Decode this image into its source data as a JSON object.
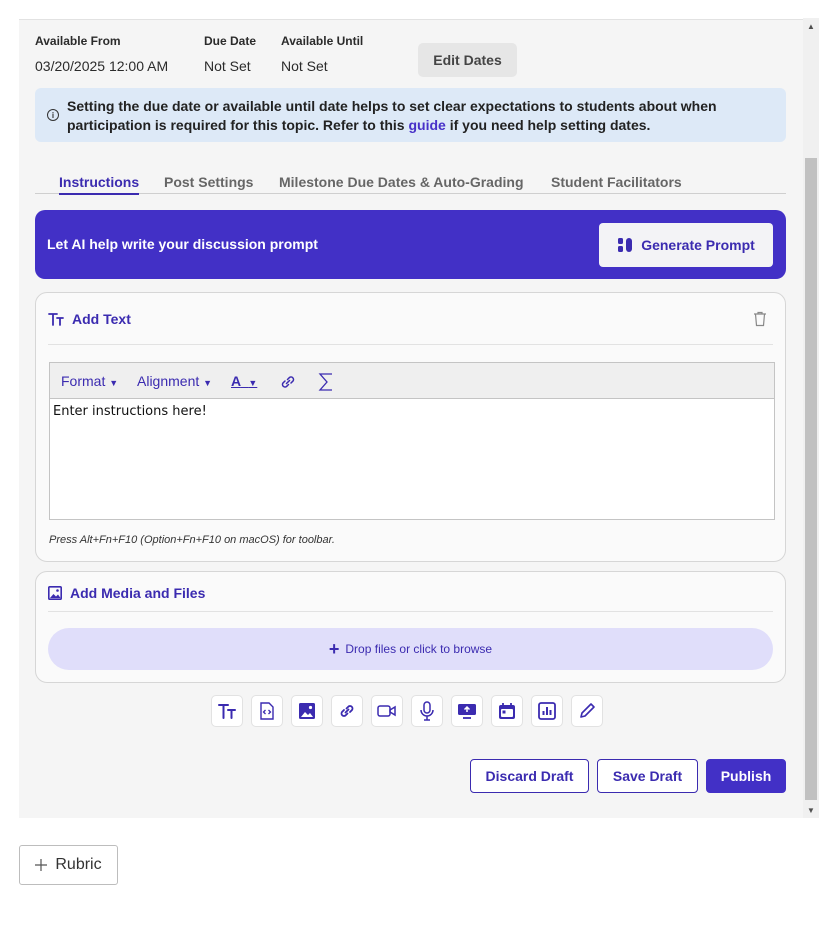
{
  "dates": {
    "available_from_label": "Available From",
    "available_from_value": "03/20/2025 12:00 AM",
    "due_date_label": "Due Date",
    "due_date_value": "Not Set",
    "available_until_label": "Available Until",
    "available_until_value": "Not Set",
    "edit_button": "Edit Dates"
  },
  "info": {
    "text_before": "Setting the due date or available until date helps to set clear expectations to students about when participation is required for this topic. Refer to this ",
    "link": "guide",
    "text_after": " if you need help setting dates."
  },
  "tabs": [
    {
      "label": "Instructions",
      "active": true
    },
    {
      "label": "Post Settings",
      "active": false
    },
    {
      "label": "Milestone Due Dates & Auto-Grading",
      "active": false
    },
    {
      "label": "Student Facilitators",
      "active": false
    }
  ],
  "ai": {
    "text": "Let AI help write your discussion prompt",
    "button": "Generate Prompt"
  },
  "text_block": {
    "title": "Add Text",
    "toolbar": {
      "format": "Format",
      "alignment": "Alignment",
      "font_color": "A"
    },
    "body": "Enter instructions here!",
    "hint": "Press Alt+Fn+F10 (Option+Fn+F10 on macOS) for toolbar."
  },
  "media_block": {
    "title": "Add Media and Files",
    "dropzone": "Drop files or click to browse"
  },
  "block_buttons": [
    "text-icon",
    "embed-icon",
    "image-icon",
    "link-icon",
    "video-icon",
    "microphone-icon",
    "screen-share-icon",
    "calendar-icon",
    "chart-icon",
    "pencil-icon"
  ],
  "actions": {
    "discard": "Discard Draft",
    "save": "Save Draft",
    "publish": "Publish"
  },
  "rubric": {
    "label": "Rubric"
  },
  "colors": {
    "brand": "#4230c6",
    "info_bg": "#dde9f7",
    "dropzone_bg": "#e0defa"
  }
}
